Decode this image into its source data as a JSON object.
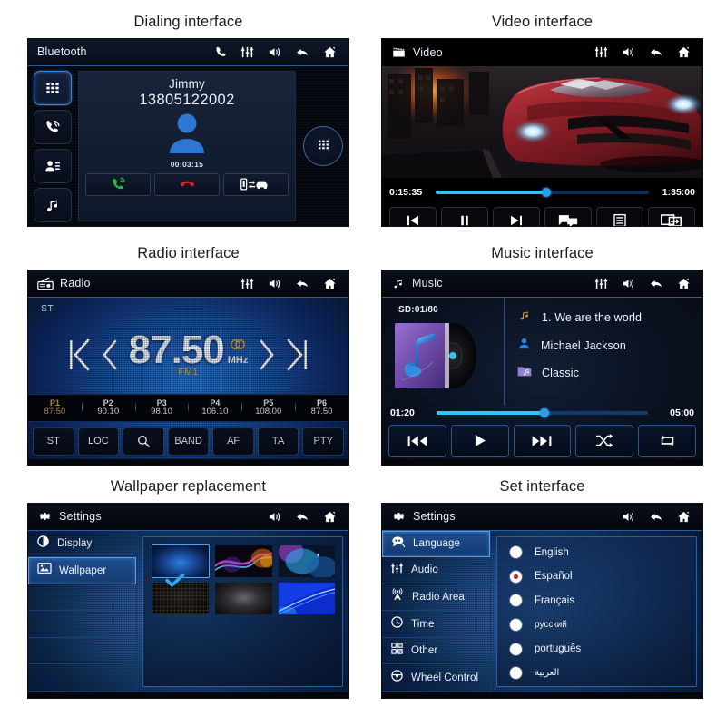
{
  "panels": {
    "dialing": {
      "caption": "Dialing interface",
      "header_title": "Bluetooth",
      "header_icons": [
        "phone-icon",
        "equalizer-icon",
        "volume-icon",
        "back-icon",
        "home-icon"
      ],
      "sidebar": [
        {
          "name": "keypad-icon",
          "selected": true
        },
        {
          "name": "call-history-icon",
          "selected": false
        },
        {
          "name": "contacts-icon",
          "selected": false
        },
        {
          "name": "music-icon",
          "selected": false
        }
      ],
      "contact_name": "Jimmy",
      "phone_number": "13805122002",
      "call_duration": "00:03:15",
      "actions": [
        "answer-call-icon",
        "end-call-icon",
        "transfer-audio-icon"
      ],
      "dialpad_button": "keypad-icon"
    },
    "video": {
      "caption": "Video interface",
      "header_title": "Video",
      "header_icon": "movie-clapper-icon",
      "header_icons": [
        "equalizer-icon",
        "volume-icon",
        "back-icon",
        "home-icon"
      ],
      "time_elapsed": "0:15:35",
      "time_total": "1:35:00",
      "progress_percent": 52,
      "controls": [
        "previous-icon",
        "pause-icon",
        "next-icon",
        "subtitle-icon",
        "playlist-icon",
        "screen-mirror-icon"
      ]
    },
    "radio": {
      "caption": "Radio interface",
      "header_title": "Radio",
      "header_icon": "radio-icon",
      "header_icons": [
        "equalizer-icon",
        "volume-icon",
        "back-icon",
        "home-icon"
      ],
      "stereo_label": "ST",
      "frequency": "87.50",
      "unit": "MHz",
      "band": "FM1",
      "stereo_indicator": "stereo-icon",
      "nav": [
        "seek-start-icon",
        "tune-down-icon",
        "tune-up-icon",
        "seek-end-icon"
      ],
      "presets": [
        {
          "name": "P1",
          "value": "87.50",
          "active": true
        },
        {
          "name": "P2",
          "value": "90.10",
          "active": false
        },
        {
          "name": "P3",
          "value": "98.10",
          "active": false
        },
        {
          "name": "P4",
          "value": "106.10",
          "active": false
        },
        {
          "name": "P5",
          "value": "108.00",
          "active": false
        },
        {
          "name": "P6",
          "value": "87.50",
          "active": false
        }
      ],
      "functions": [
        "ST",
        "LOC",
        "search-icon",
        "BAND",
        "AF",
        "TA",
        "PTY"
      ]
    },
    "music": {
      "caption": "Music interface",
      "header_title": "Music",
      "header_icon": "music-note-icon",
      "header_icons": [
        "equalizer-icon",
        "volume-icon",
        "back-icon",
        "home-icon"
      ],
      "source_counter": "SD:01/80",
      "track_title": "1.  We are the world",
      "artist": "Michael Jackson",
      "genre": "Classic",
      "time_elapsed": "01:20",
      "time_total": "05:00",
      "progress_percent": 51,
      "controls": [
        "previous-track-icon",
        "play-icon",
        "next-track-icon",
        "shuffle-icon",
        "repeat-icon"
      ]
    },
    "wallpaper": {
      "caption": "Wallpaper replacement",
      "header_title": "Settings",
      "header_icon": "gear-icon",
      "header_icons": [
        "volume-icon",
        "back-icon",
        "home-icon"
      ],
      "sidebar": [
        {
          "label": "Display",
          "icon": "contrast-icon",
          "selected": false
        },
        {
          "label": "Wallpaper",
          "icon": "image-icon",
          "selected": true
        },
        {
          "label": "",
          "icon": "",
          "selected": false
        },
        {
          "label": "",
          "icon": "",
          "selected": false
        },
        {
          "label": "",
          "icon": "",
          "selected": false
        },
        {
          "label": "",
          "icon": "",
          "selected": false
        }
      ],
      "thumbnails": [
        {
          "name": "wallpaper-blue-glow",
          "selected": true
        },
        {
          "name": "wallpaper-neon-wave",
          "selected": false
        },
        {
          "name": "wallpaper-cyan-bloom",
          "selected": false
        },
        {
          "name": "wallpaper-dark-grid",
          "selected": false
        },
        {
          "name": "wallpaper-grey-fade",
          "selected": false
        },
        {
          "name": "wallpaper-blue-curve",
          "selected": false
        }
      ]
    },
    "settings": {
      "caption": "Set interface",
      "header_title": "Settings",
      "header_icon": "gear-icon",
      "header_icons": [
        "volume-icon",
        "back-icon",
        "home-icon"
      ],
      "sidebar": [
        {
          "label": "Language",
          "icon": "speech-bubble-icon",
          "selected": true
        },
        {
          "label": "Audio",
          "icon": "equalizer-icon",
          "selected": false
        },
        {
          "label": "Radio Area",
          "icon": "antenna-icon",
          "selected": false
        },
        {
          "label": "Time",
          "icon": "clock-icon",
          "selected": false
        },
        {
          "label": "Other",
          "icon": "apps-icon",
          "selected": false
        },
        {
          "label": "Wheel Control",
          "icon": "steering-wheel-icon",
          "selected": false
        }
      ],
      "languages": [
        {
          "label": "English",
          "selected": false
        },
        {
          "label": "Español",
          "selected": true
        },
        {
          "label": "Français",
          "selected": false
        },
        {
          "label": "русский",
          "selected": false
        },
        {
          "label": "português",
          "selected": false
        },
        {
          "label": "العربية",
          "selected": false
        }
      ]
    }
  },
  "colors": {
    "accent_blue": "#2ec4f3",
    "selected_border": "#59a0e8",
    "amber": "#d6a23a",
    "answer_green": "#27b03c",
    "hangup_red": "#e02222",
    "radio_dot": "#d21d1d"
  }
}
